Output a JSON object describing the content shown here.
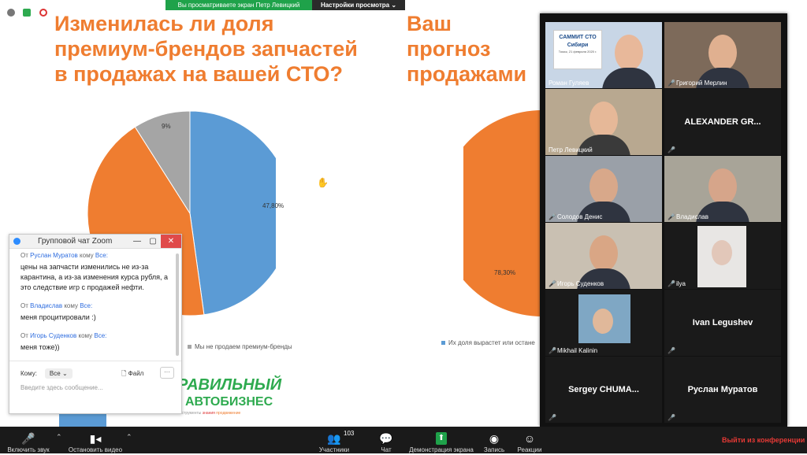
{
  "share_bar": {
    "status": "Вы просматриваете экран Петр Левицкий",
    "view_options": "Настройки просмотра"
  },
  "slide_left": {
    "title": "Изменилась ли доля премиум-брендов запчастей в продажах на вашей СТО?",
    "legend": "Мы не продаем премиум-бренды",
    "chart_data": {
      "type": "pie",
      "values": [
        47.8,
        43.2,
        9
      ],
      "labels": [
        "47,80%",
        "",
        "9%"
      ],
      "colors": [
        "#5b9bd5",
        "#ef7d30",
        "#a5a5a5"
      ]
    }
  },
  "slide_right": {
    "title": "Ваш прогноз продажами п запчастей до",
    "legend": "Их доля вырастет или остане",
    "chart_data": {
      "type": "pie",
      "values": [
        78.3
      ],
      "labels": [
        "78,30%"
      ],
      "colors": [
        "#ef7d30"
      ]
    }
  },
  "logo": {
    "line1": "РАВИЛЬНЫЙ",
    "line2": "АВТОБИЗНЕС",
    "tag1": "инструменты",
    "tag2": "знания",
    "tag3": "продвижение"
  },
  "participants": [
    {
      "name": "Роман Гуляев",
      "muted": false
    },
    {
      "name": "Григорий Мерлин",
      "muted": true
    },
    {
      "name": "Петр Левицкий",
      "muted": false
    },
    {
      "name": "ALEXANDER GR...",
      "muted": true
    },
    {
      "name": "Солодов Денис",
      "muted": true
    },
    {
      "name": "Владислав",
      "muted": true
    },
    {
      "name": "Игорь Суденков",
      "muted": true
    },
    {
      "name": "ilya",
      "muted": true
    },
    {
      "name": "Mikhail Kalinin",
      "muted": true
    },
    {
      "name": "Ivan Legushev",
      "muted": true
    },
    {
      "name": "Sergey CHUMA...",
      "muted": true
    },
    {
      "name": "Руслан Муратов",
      "muted": true
    }
  ],
  "banner": {
    "line1": "САММИТ СТО",
    "line2": "Сибири",
    "line3": "Томск, 21 февраля 2020 г."
  },
  "chat": {
    "title": "Групповой чат Zoom",
    "messages": [
      {
        "from_label": "От",
        "from": "Руслан Муратов",
        "to_label": "кому",
        "to": "Все:",
        "text": "цены на запчасти изменились не из-за карантина, а из-за изменения курса рубля, а это следствие игр с продажей нефти."
      },
      {
        "from_label": "От",
        "from": "Владислав",
        "to_label": "кому",
        "to": "Все:",
        "text": "меня процитировали :)"
      },
      {
        "from_label": "От",
        "from": "Игорь Суденков",
        "to_label": "кому",
        "to": "Все:",
        "text": "меня тоже))"
      }
    ],
    "to_label": "Кому:",
    "to_value": "Все",
    "file_label": "Файл",
    "more": "···",
    "placeholder": "Введите здесь сообщение..."
  },
  "toolbar": {
    "mute": "Включить звук",
    "video": "Остановить видео",
    "participants": "Участники",
    "participants_count": "103",
    "chat": "Чат",
    "share": "Демонстрация экрана",
    "record": "Запись",
    "reactions": "Реакции",
    "leave": "Выйти из конференции"
  }
}
